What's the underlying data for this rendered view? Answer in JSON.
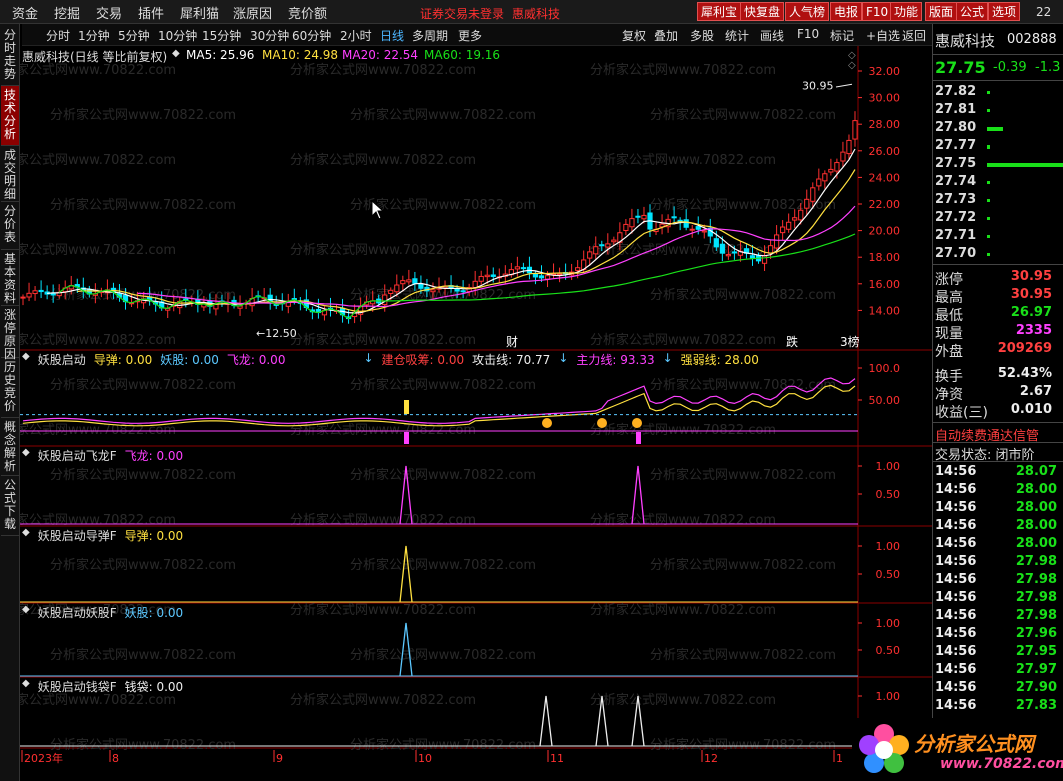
{
  "menubar": {
    "items": [
      "资金",
      "挖掘",
      "交易",
      "插件",
      "犀利猫",
      "涨原因",
      "竞价额"
    ],
    "notice": "证券交易未登录",
    "stock_link": "惠威科技",
    "buttons": [
      "犀利宝",
      "快复盘",
      "人气榜",
      "电报",
      "F10",
      "功能",
      "版面",
      "公式",
      "选项"
    ],
    "page": "22"
  },
  "timeframes": {
    "items": [
      "分时",
      "1分钟",
      "5分钟",
      "10分钟",
      "15分钟",
      "30分钟",
      "60分钟",
      "2小时",
      "日线",
      "多周期",
      "更多"
    ],
    "active": "日线"
  },
  "tools": [
    "复权",
    "叠加",
    "多股",
    "统计",
    "画线",
    "F10",
    "标记",
    "+自选",
    "返回"
  ],
  "side_tabs": [
    "分时走势",
    "技术分析",
    "成交明细",
    "分价表",
    "基本资料",
    "涨停原因",
    "历史竞价",
    "概念解析",
    "公式下载"
  ],
  "side_active": "技术分析",
  "main": {
    "title": "惠威科技(日线 等比前复权)",
    "ma": [
      {
        "label": "MA5: 25.96",
        "color": "#ffffff"
      },
      {
        "label": "MA10: 24.98",
        "color": "#ffe040"
      },
      {
        "label": "MA20: 22.54",
        "color": "#ff40ff"
      },
      {
        "label": "MA60: 19.16",
        "color": "#19e019"
      }
    ],
    "high_label": "30.95",
    "low_label": "12.50",
    "markers": [
      "财",
      "跌",
      "3榜"
    ]
  },
  "panels": [
    {
      "title": "妖股启动",
      "items": [
        {
          "t": "导弹: 0.00",
          "c": "#ffe040"
        },
        {
          "t": "妖股: 0.00",
          "c": "#5cc8ff"
        },
        {
          "t": "飞龙: 0.00",
          "c": "#ff40ff"
        },
        {
          "t": "建仓吸筹: 0.00",
          "c": "#ff4040"
        },
        {
          "t": "攻击线: 70.77",
          "c": "#eee"
        },
        {
          "t": "主力线: 93.33",
          "c": "#ff40ff"
        },
        {
          "t": "强弱线: 28.00",
          "c": "#ffe040"
        }
      ]
    },
    {
      "title": "妖股启动飞龙F",
      "items": [
        {
          "t": "飞龙: 0.00",
          "c": "#ff40ff"
        }
      ]
    },
    {
      "title": "妖股启动导弹F",
      "items": [
        {
          "t": "导弹: 0.00",
          "c": "#ffe040"
        }
      ]
    },
    {
      "title": "妖股启动妖股F",
      "items": [
        {
          "t": "妖股: 0.00",
          "c": "#5cc8ff"
        }
      ]
    },
    {
      "title": "妖股启动钱袋F",
      "items": [
        {
          "t": "钱袋: 0.00",
          "c": "#eee"
        }
      ]
    }
  ],
  "axes": {
    "main": [
      "32.00",
      "30.00",
      "28.00",
      "26.00",
      "24.00",
      "22.00",
      "20.00",
      "18.00",
      "16.00",
      "14.00"
    ],
    "p1": [
      "100.0",
      "50.00"
    ],
    "p2": [
      "1.00",
      "0.50"
    ],
    "p3": [
      "1.00",
      "0.50"
    ],
    "p4": [
      "1.00",
      "0.50"
    ],
    "p5": [
      "1.00",
      "0.50"
    ]
  },
  "dates": [
    "2023年",
    "8",
    "9",
    "10",
    "11",
    "12",
    "1"
  ],
  "watermark": "分析家公式网www.70822.com",
  "right": {
    "name": "惠威科技",
    "code": "002888",
    "price": "27.75",
    "change": "-0.39",
    "pct": "-1.3",
    "book": [
      [
        "27.82",
        "red"
      ],
      [
        "27.81",
        "red"
      ],
      [
        "27.80",
        "red"
      ],
      [
        "27.77",
        "red"
      ],
      [
        "27.75",
        "red"
      ],
      [
        "27.74",
        "green"
      ],
      [
        "27.73",
        "green"
      ],
      [
        "27.72",
        "green"
      ],
      [
        "27.71",
        "green"
      ],
      [
        "27.70",
        "green"
      ]
    ],
    "stats1": [
      [
        "涨停",
        "30.95",
        "red"
      ],
      [
        "最高",
        "30.95",
        "red"
      ],
      [
        "最低",
        "26.97",
        "green"
      ],
      [
        "现量",
        "2335",
        "mag"
      ],
      [
        "外盘",
        "209269",
        "red"
      ]
    ],
    "stats2": [
      [
        "换手",
        "52.43%",
        "white"
      ],
      [
        "净资",
        "2.67",
        "white"
      ],
      [
        "收益(三)",
        "0.010",
        "white"
      ]
    ],
    "auto": "自动续费通达信管",
    "status": "交易状态: 闭市阶",
    "ticks": [
      [
        "14:56",
        "28.07"
      ],
      [
        "14:56",
        "28.00"
      ],
      [
        "14:56",
        "28.00"
      ],
      [
        "14:56",
        "28.00"
      ],
      [
        "14:56",
        "28.00"
      ],
      [
        "14:56",
        "27.98"
      ],
      [
        "14:56",
        "27.98"
      ],
      [
        "14:56",
        "27.98"
      ],
      [
        "14:56",
        "27.98"
      ],
      [
        "14:56",
        "27.96"
      ],
      [
        "14:56",
        "27.95"
      ],
      [
        "14:56",
        "27.97"
      ],
      [
        "14:56",
        "27.90"
      ],
      [
        "14:56",
        "27.83"
      ]
    ]
  },
  "logo": {
    "text": "分析家公式网",
    "url": "www.70822.com"
  }
}
